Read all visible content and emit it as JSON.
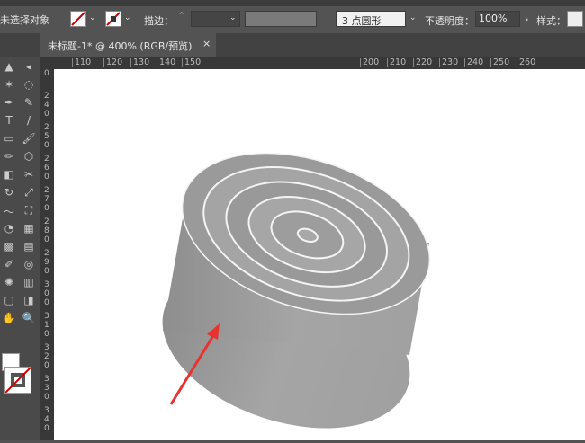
{
  "control_bar": {
    "selection_status": "未选择对象",
    "stroke_label": "描边：",
    "brush_value": "3 点圆形",
    "opacity_label": "不透明度：",
    "opacity_value": "100%",
    "style_label": "样式："
  },
  "document_tab": {
    "title": "未标题-1* @ 400% (RGB/预览)",
    "close": "×"
  },
  "horizontal_ruler": [
    "110",
    "120",
    "130",
    "140",
    "150",
    "200",
    "210",
    "220",
    "230",
    "240",
    "250",
    "260"
  ],
  "vertical_ruler": [
    "0",
    "240",
    "250",
    "260",
    "270",
    "280",
    "290",
    "300",
    "310",
    "320",
    "330",
    "340"
  ],
  "tools": [
    "selection",
    "direct-selection",
    "magic-wand",
    "lasso",
    "pen",
    "curvature",
    "type",
    "line",
    "rectangle",
    "paintbrush",
    "pencil",
    "shaper",
    "eraser",
    "scissors",
    "rotate",
    "scale",
    "warp",
    "free-transform",
    "shape-builder",
    "perspective-grid",
    "mesh",
    "gradient",
    "eyedropper",
    "blend",
    "symbol-sprayer",
    "column-graph",
    "artboard",
    "slice",
    "hand",
    "zoom"
  ],
  "colors": {
    "accent_arrow": "#e8322f",
    "object": "#a8a8a8",
    "panel": "#535353"
  }
}
